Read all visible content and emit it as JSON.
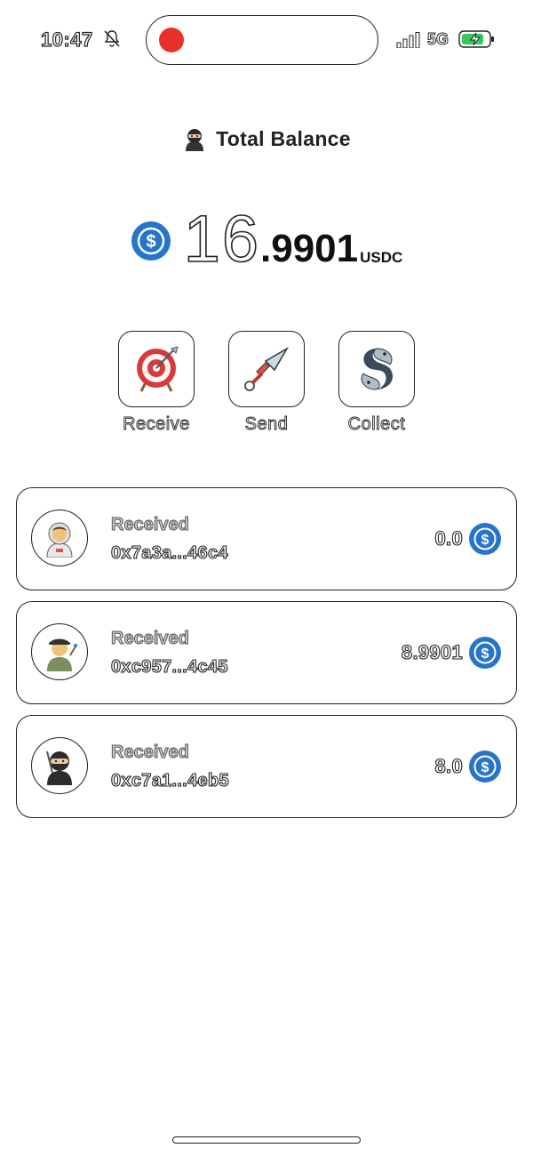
{
  "status_bar": {
    "time": "10:47",
    "network": "5G",
    "icons": [
      "bell-slash-icon",
      "record-indicator",
      "signal-icon",
      "battery-charging-icon"
    ]
  },
  "header": {
    "title": "Total Balance",
    "icon": "ninja-icon"
  },
  "balance": {
    "integer": "16",
    "decimal": ".9901",
    "unit": "USDC",
    "icon": "usdc-icon"
  },
  "actions": [
    {
      "label": "Receive",
      "icon": "target-icon"
    },
    {
      "label": "Send",
      "icon": "kunai-icon"
    },
    {
      "label": "Collect",
      "icon": "yin-yang-fish-icon"
    }
  ],
  "transactions": [
    {
      "type": "Received",
      "address": "0x7a3a...46c4",
      "amount": "0.0",
      "avatar": "astronaut-avatar-icon"
    },
    {
      "type": "Received",
      "address": "0xc957...4c45",
      "amount": "8.9901",
      "avatar": "artist-avatar-icon"
    },
    {
      "type": "Received",
      "address": "0xc7a1...4eb5",
      "amount": "8.0",
      "avatar": "ninja-avatar-icon"
    }
  ],
  "colors": {
    "usdc_blue": "#2775ca",
    "record_red": "#e8302a",
    "battery_green": "#34c759"
  }
}
